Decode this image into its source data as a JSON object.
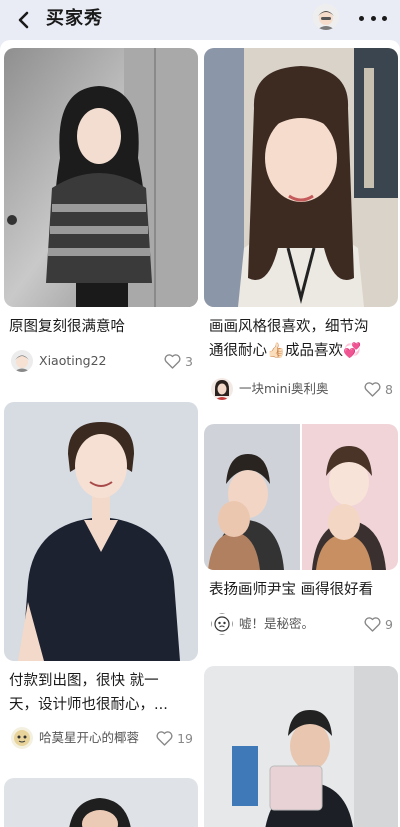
{
  "header": {
    "title": "买家秀",
    "back_icon": "chevron-left-icon",
    "more_icon": "more-dots-icon"
  },
  "posts": [
    {
      "caption": "原图复刻很满意哈",
      "author": "Xiaoting22",
      "likes": "3"
    },
    {
      "caption_line1": "画画风格很喜欢，细节沟",
      "caption_line2": "通很耐心👍🏻成品喜欢💞",
      "author": "一块mini奥利奥",
      "likes": "8"
    },
    {
      "caption_line1": "付款到出图，很快 就一",
      "caption_line2": "天，设计师也很耐心，...",
      "author": "哈莫星开心的椰蓉",
      "likes": "19"
    },
    {
      "caption": "表扬画师尹宝 画得很好看",
      "author": "嘘！是秘密。",
      "likes": "9"
    },
    {
      "caption": "",
      "author": "",
      "likes": ""
    },
    {
      "caption": "",
      "author": "",
      "likes": ""
    }
  ],
  "colors": {
    "background": "#e9ecf4",
    "card": "#ffffff",
    "like": "#888888"
  }
}
